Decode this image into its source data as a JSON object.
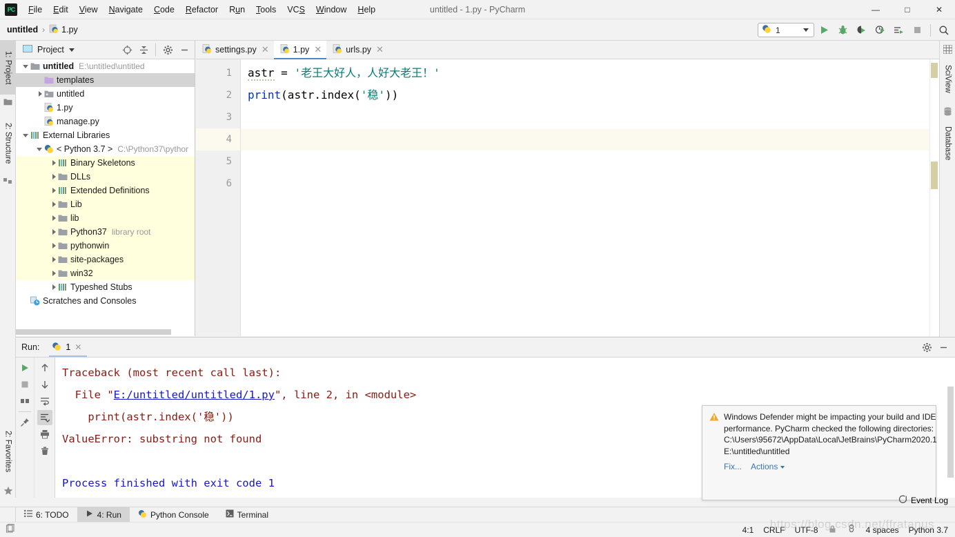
{
  "window": {
    "title": "untitled - 1.py - PyCharm",
    "minimize": "—",
    "maximize": "□",
    "close": "✕"
  },
  "menu": [
    {
      "label": "File"
    },
    {
      "label": "Edit"
    },
    {
      "label": "View"
    },
    {
      "label": "Navigate"
    },
    {
      "label": "Code"
    },
    {
      "label": "Refactor"
    },
    {
      "label": "Run"
    },
    {
      "label": "Tools"
    },
    {
      "label": "VCS"
    },
    {
      "label": "Window"
    },
    {
      "label": "Help"
    }
  ],
  "breadcrumb": {
    "project": "untitled",
    "separator": "›",
    "file": "1.py"
  },
  "toolbar": {
    "run_config": "1",
    "run_label": "Run",
    "debug_label": "Debug",
    "coverage_label": "Run with Coverage",
    "profile_label": "Profile",
    "more_label": "Run/Debug",
    "stop_label": "Stop",
    "search_label": "Search Everywhere"
  },
  "left_strip": {
    "project_tab": "1: Project",
    "structure_tab": "2: Structure",
    "favorites_tab": "2: Favorites"
  },
  "right_strip": {
    "sciview_tab": "SciView",
    "database_tab": "Database"
  },
  "project_panel": {
    "title": "Project",
    "tree": [
      {
        "label": "untitled",
        "sub": "E:\\untitled\\untitled",
        "indent": 0,
        "arrow": "open",
        "icon": "folder-module",
        "bold": true,
        "selected": false,
        "lib": false
      },
      {
        "label": "templates",
        "sub": "",
        "indent": 1,
        "arrow": "none",
        "icon": "folder-template",
        "bold": false,
        "selected": true,
        "lib": false
      },
      {
        "label": "untitled",
        "sub": "",
        "indent": 1,
        "arrow": "closed",
        "icon": "folder-source",
        "bold": false,
        "selected": false,
        "lib": false
      },
      {
        "label": "1.py",
        "sub": "",
        "indent": 1,
        "arrow": "none",
        "icon": "python-file",
        "bold": false,
        "selected": false,
        "lib": false
      },
      {
        "label": "manage.py",
        "sub": "",
        "indent": 1,
        "arrow": "none",
        "icon": "python-file",
        "bold": false,
        "selected": false,
        "lib": false
      },
      {
        "label": "External Libraries",
        "sub": "",
        "indent": 0,
        "arrow": "open",
        "icon": "library",
        "bold": false,
        "selected": false,
        "lib": false
      },
      {
        "label": "< Python 3.7 >",
        "sub": "C:\\Python37\\pythor",
        "indent": 1,
        "arrow": "open",
        "icon": "python-sdk",
        "bold": false,
        "selected": false,
        "lib": false
      },
      {
        "label": "Binary Skeletons",
        "sub": "",
        "indent": 2,
        "arrow": "closed",
        "icon": "library",
        "bold": false,
        "selected": false,
        "lib": true
      },
      {
        "label": "DLLs",
        "sub": "",
        "indent": 2,
        "arrow": "closed",
        "icon": "folder",
        "bold": false,
        "selected": false,
        "lib": true
      },
      {
        "label": "Extended Definitions",
        "sub": "",
        "indent": 2,
        "arrow": "closed",
        "icon": "library",
        "bold": false,
        "selected": false,
        "lib": true
      },
      {
        "label": "Lib",
        "sub": "",
        "indent": 2,
        "arrow": "closed",
        "icon": "folder",
        "bold": false,
        "selected": false,
        "lib": true
      },
      {
        "label": "lib",
        "sub": "",
        "indent": 2,
        "arrow": "closed",
        "icon": "folder",
        "bold": false,
        "selected": false,
        "lib": true
      },
      {
        "label": "Python37",
        "sub": "library root",
        "indent": 2,
        "arrow": "closed",
        "icon": "folder",
        "bold": false,
        "selected": false,
        "lib": true
      },
      {
        "label": "pythonwin",
        "sub": "",
        "indent": 2,
        "arrow": "closed",
        "icon": "folder",
        "bold": false,
        "selected": false,
        "lib": true
      },
      {
        "label": "site-packages",
        "sub": "",
        "indent": 2,
        "arrow": "closed",
        "icon": "folder",
        "bold": false,
        "selected": false,
        "lib": true
      },
      {
        "label": "win32",
        "sub": "",
        "indent": 2,
        "arrow": "closed",
        "icon": "folder",
        "bold": false,
        "selected": false,
        "lib": true
      },
      {
        "label": "Typeshed Stubs",
        "sub": "",
        "indent": 2,
        "arrow": "closed",
        "icon": "library",
        "bold": false,
        "selected": false,
        "lib": false
      },
      {
        "label": "Scratches and Consoles",
        "sub": "",
        "indent": 0,
        "arrow": "none",
        "icon": "scratch",
        "bold": false,
        "selected": false,
        "lib": false
      }
    ]
  },
  "editor": {
    "tabs": [
      {
        "label": "settings.py",
        "active": false,
        "close": "✕"
      },
      {
        "label": "1.py",
        "active": true,
        "close": "✕"
      },
      {
        "label": "urls.py",
        "active": false,
        "close": "✕"
      }
    ],
    "line_numbers": [
      "1",
      "2",
      "3",
      "4",
      "5",
      "6"
    ],
    "current_line": 4,
    "lines": [
      {
        "n": 1,
        "segments": [
          {
            "text": "astr",
            "cls": "tk-plain squiggle"
          },
          {
            "text": " = ",
            "cls": "tk-plain"
          },
          {
            "text": "'老王大好人，人好大老王！'",
            "cls": "tk-str"
          }
        ]
      },
      {
        "n": 2,
        "segments": [
          {
            "text": "print",
            "cls": "tk-fn"
          },
          {
            "text": "(astr.index(",
            "cls": "tk-plain"
          },
          {
            "text": "'稳'",
            "cls": "tk-str"
          },
          {
            "text": "))",
            "cls": "tk-plain"
          }
        ]
      },
      {
        "n": 3,
        "segments": []
      },
      {
        "n": 4,
        "segments": []
      },
      {
        "n": 5,
        "segments": []
      },
      {
        "n": 6,
        "segments": []
      }
    ]
  },
  "run_panel": {
    "label": "Run:",
    "tab": "1",
    "tab_close": "✕",
    "console": [
      {
        "text": "Traceback (most recent call last):",
        "type": "error",
        "link": null
      },
      {
        "text": "  File \"E:/untitled/untitled/1.py\", line 2, in <module>",
        "type": "error",
        "link": "E:/untitled/untitled/1.py"
      },
      {
        "text": "    print(astr.index('稳'))",
        "type": "error",
        "link": null
      },
      {
        "text": "ValueError: substring not found",
        "type": "error",
        "link": null
      },
      {
        "text": "",
        "type": "error",
        "link": null
      },
      {
        "text": "Process finished with exit code 1",
        "type": "info",
        "link": null
      }
    ],
    "tools": [
      {
        "name": "rerun-button",
        "glyph": "▶"
      },
      {
        "name": "stop-button",
        "glyph": "■"
      },
      {
        "name": "layout-button",
        "glyph": "▤"
      },
      {
        "name": "pin-tab-button",
        "glyph": "📌"
      }
    ],
    "tools2": [
      {
        "name": "up-stack-trace-button",
        "glyph": "↑"
      },
      {
        "name": "down-stack-trace-button",
        "glyph": "↓"
      },
      {
        "name": "soft-wrap-button",
        "glyph": "⤶"
      },
      {
        "name": "scroll-to-end-button",
        "glyph": "⇥"
      },
      {
        "name": "print-button",
        "glyph": "🖨"
      },
      {
        "name": "clear-all-button",
        "glyph": "🗑"
      }
    ]
  },
  "notification": {
    "icon": "warning-icon",
    "message": "Windows Defender might be impacting your build and IDE performance. PyCharm checked the following directories:",
    "path1": "C:\\Users\\95672\\AppData\\Local\\JetBrains\\PyCharm2020.1",
    "path2": "E:\\untitled\\untitled",
    "fix_label": "Fix...",
    "actions_label": "Actions"
  },
  "bottom_tabs": [
    {
      "label": "6: TODO",
      "selected": false,
      "icon": "todo-icon"
    },
    {
      "label": "4: Run",
      "selected": true,
      "icon": "run-icon"
    },
    {
      "label": "Python Console",
      "selected": false,
      "icon": "python-icon"
    },
    {
      "label": "Terminal",
      "selected": false,
      "icon": "terminal-icon"
    }
  ],
  "status_bar": {
    "event_log": "Event Log",
    "caret": "4:1",
    "line_separator": "CRLF",
    "encoding": "UTF-8",
    "indent": "4 spaces",
    "interpreter": "Python 3.7"
  },
  "watermark": "https://blog.csdn.net/ffratanus"
}
